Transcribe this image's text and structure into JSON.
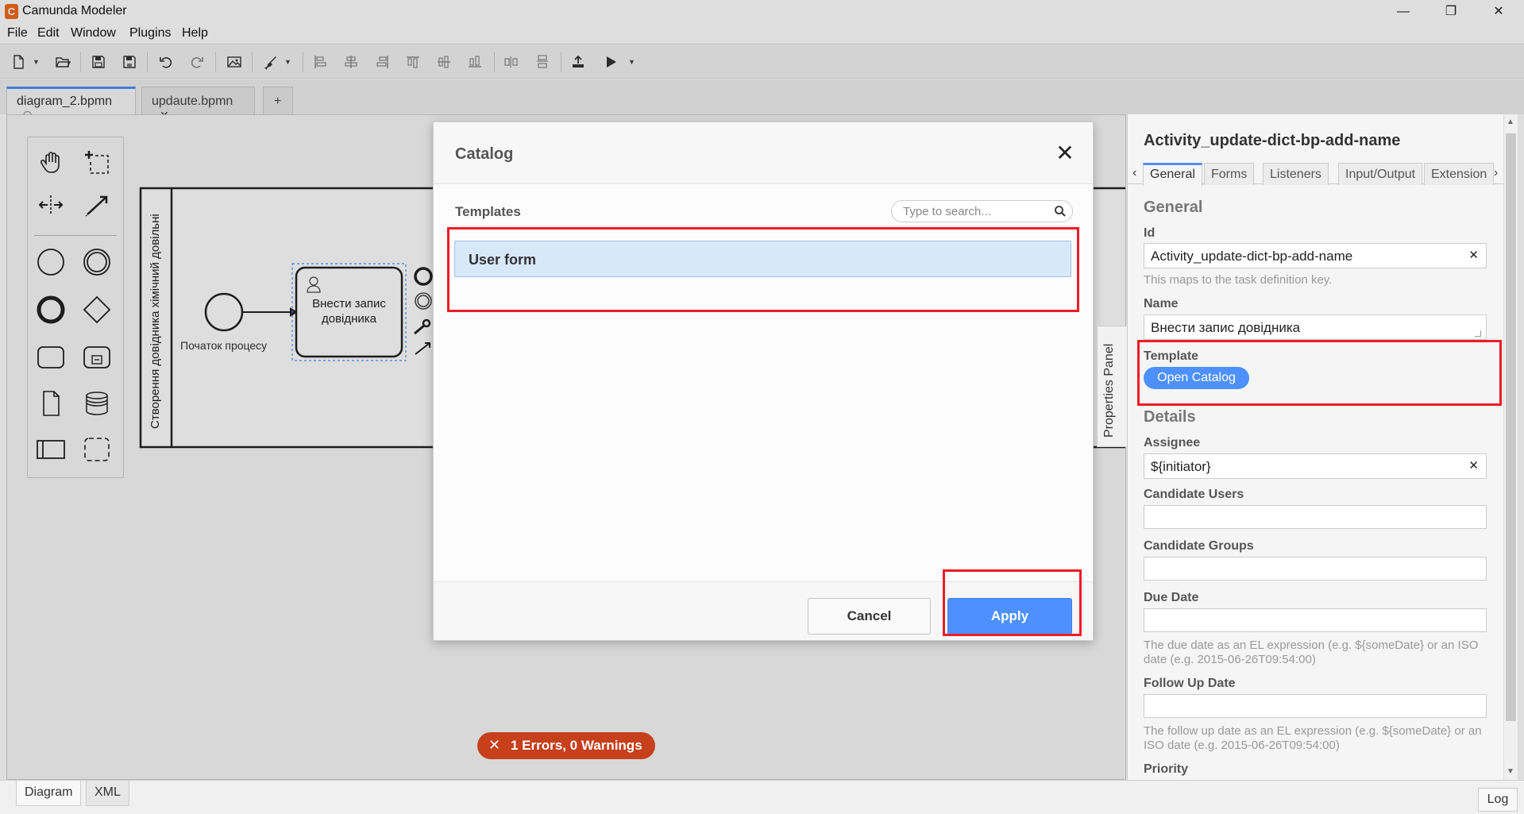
{
  "window": {
    "title": "Camunda Modeler",
    "app_icon": "C",
    "controls": {
      "minimize": "—",
      "restore": "❐",
      "close": "✕"
    }
  },
  "menu": [
    "File",
    "Edit",
    "Window",
    "Plugins",
    "Help"
  ],
  "toolbar": {
    "icons": [
      "new-file-icon",
      "open-folder-icon",
      "save-icon",
      "save-as-icon",
      "undo-icon",
      "redo-icon",
      "image-export-icon",
      "paint-brush-icon",
      "align-left-icon",
      "align-center-icon",
      "align-right-icon",
      "align-top-icon",
      "align-middle-icon",
      "align-bottom-icon",
      "distribute-horizontal-icon",
      "distribute-vertical-icon",
      "deploy-icon",
      "start-instance-icon"
    ]
  },
  "tabs": [
    {
      "label": "diagram_2.bpmn",
      "active": true,
      "state": "unsaved-dot"
    },
    {
      "label": "updaute.bpmn",
      "active": false,
      "close": "✕"
    },
    {
      "label": "+"
    }
  ],
  "diagram": {
    "pool_name": "Створення довідника хімічний довільні",
    "start_event_label": "Початок процесу",
    "task_label_line1": "Внести запис",
    "task_label_line2": "довідника"
  },
  "catalog": {
    "title": "Catalog",
    "close": "✕",
    "templates_label": "Templates",
    "search_placeholder": "Type to search...",
    "items": [
      "User form"
    ],
    "cancel_label": "Cancel",
    "apply_label": "Apply"
  },
  "status": {
    "error_icon": "✕",
    "errors_text": "1 Errors, 0 Warnings"
  },
  "properties_toggle": "Properties Panel",
  "properties": {
    "title": "Activity_update-dict-bp-add-name",
    "tabs": [
      "General",
      "Forms",
      "Listeners",
      "Input/Output",
      "Extension"
    ],
    "active_tab": "General",
    "arrow_left": "‹",
    "arrow_right": "›",
    "general_title": "General",
    "id_label": "Id",
    "id_value": "Activity_update-dict-bp-add-name",
    "id_help": "This maps to the task definition key.",
    "name_label": "Name",
    "name_value": "Внести запис довідника",
    "template_label": "Template",
    "open_catalog_label": "Open Catalog",
    "details_title": "Details",
    "assignee_label": "Assignee",
    "assignee_value": "${initiator}",
    "candidate_users_label": "Candidate Users",
    "candidate_groups_label": "Candidate Groups",
    "due_date_label": "Due Date",
    "due_date_help": "The due date as an EL expression (e.g. ${someDate} or an ISO date (e.g. 2015-06-26T09:54:00)",
    "follow_up_label": "Follow Up Date",
    "follow_up_help": "The follow up date as an EL expression (e.g. ${someDate} or an ISO date (e.g. 2015-06-26T09:54:00)",
    "priority_label": "Priority",
    "clear": "✕"
  },
  "bottom": {
    "tabs": [
      "Diagram",
      "XML"
    ],
    "active": "Diagram",
    "log_label": "Log"
  },
  "colors": {
    "accent": "#4d90fe",
    "error": "#c5401b",
    "highlight": "#ee1c25",
    "selection": "#d8e8fb"
  }
}
